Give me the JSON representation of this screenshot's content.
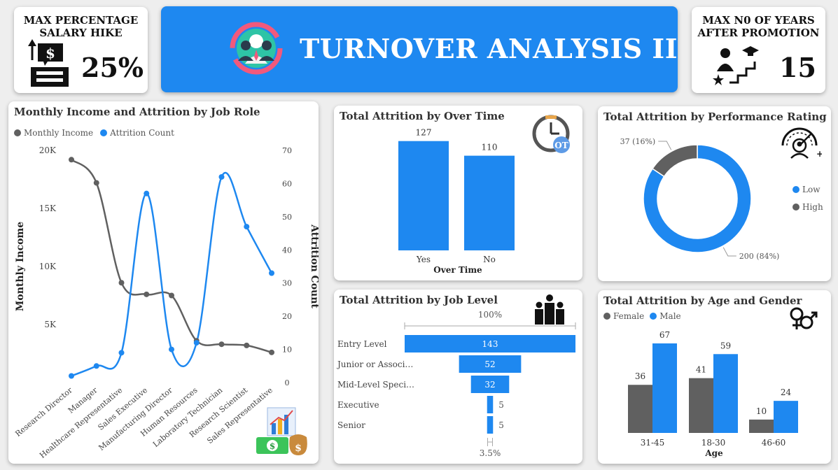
{
  "kpi_left": {
    "title_line1": "MAX PERCENTAGE",
    "title_line2": "SALARY HIKE",
    "value": "25%"
  },
  "banner": {
    "title": "TURNOVER ANALYSIS II"
  },
  "kpi_right": {
    "title_line1": "MAX N0 OF YEARS",
    "title_line2": "AFTER PROMOTION",
    "value": "15"
  },
  "colors": {
    "blue": "#1e88f0",
    "gray": "#606060",
    "banner": "#1e88f0"
  },
  "charts": {
    "income": {
      "title": "Monthly Income and Attrition by Job Role",
      "legend_income": "Monthly Income",
      "legend_attrition": "Attrition Count"
    },
    "overtime": {
      "title": "Total Attrition by Over Time"
    },
    "performance": {
      "title": "Total Attrition by Performance Rating",
      "legend_low": "Low",
      "legend_high": "High"
    },
    "joblevel": {
      "title": "Total Attrition by Job Level"
    },
    "agegender": {
      "title": "Total Attrition by Age and Gender",
      "legend_female": "Female",
      "legend_male": "Male"
    }
  },
  "chart_data": [
    {
      "type": "line",
      "title": "Monthly Income and Attrition by Job Role",
      "categories": [
        "Research Director",
        "Manager",
        "Healthcare Representative",
        "Sales Executive",
        "Manufacturing Director",
        "Human Resources",
        "Laboratory Technician",
        "Research Scientist",
        "Sales Representative"
      ],
      "series": [
        {
          "name": "Monthly Income",
          "axis": "left",
          "values": [
            19200,
            17200,
            8600,
            7600,
            7500,
            3600,
            3300,
            3200,
            2600
          ]
        },
        {
          "name": "Attrition Count",
          "axis": "right",
          "values": [
            2,
            5,
            9,
            57,
            10,
            12,
            62,
            47,
            33
          ]
        }
      ],
      "ylabel": "Monthly Income",
      "y2label": "Attrition Count",
      "ylim": [
        0,
        20000
      ],
      "y2lim": [
        0,
        70
      ],
      "yticks": [
        "5K",
        "10K",
        "15K",
        "20K"
      ],
      "y2ticks": [
        "0",
        "10",
        "20",
        "30",
        "40",
        "50",
        "60",
        "70"
      ],
      "legend": "top-left"
    },
    {
      "type": "bar",
      "title": "Total Attrition by Over Time",
      "categories": [
        "Yes",
        "No"
      ],
      "values": [
        127,
        110
      ],
      "xlabel": "Over Time"
    },
    {
      "type": "pie",
      "title": "Total Attrition by Performance Rating",
      "categories": [
        "Low",
        "High"
      ],
      "values": [
        200,
        37
      ],
      "labels": [
        "200 (84%)",
        "37 (16%)"
      ],
      "legend": "right"
    },
    {
      "type": "bar",
      "title": "Total Attrition by Job Level",
      "categories": [
        "Entry Level",
        "Junior or Associ…",
        "Mid-Level Speci…",
        "Executive",
        "Senior"
      ],
      "values": [
        143,
        52,
        32,
        5,
        5
      ],
      "top_label": "100%",
      "bottom_label": "3.5%"
    },
    {
      "type": "bar",
      "title": "Total Attrition by Age and Gender",
      "categories": [
        "31-45",
        "18-30",
        "46-60"
      ],
      "series": [
        {
          "name": "Female",
          "values": [
            36,
            41,
            10
          ]
        },
        {
          "name": "Male",
          "values": [
            67,
            59,
            24
          ]
        }
      ],
      "xlabel": "Age",
      "legend": "top-left"
    }
  ]
}
